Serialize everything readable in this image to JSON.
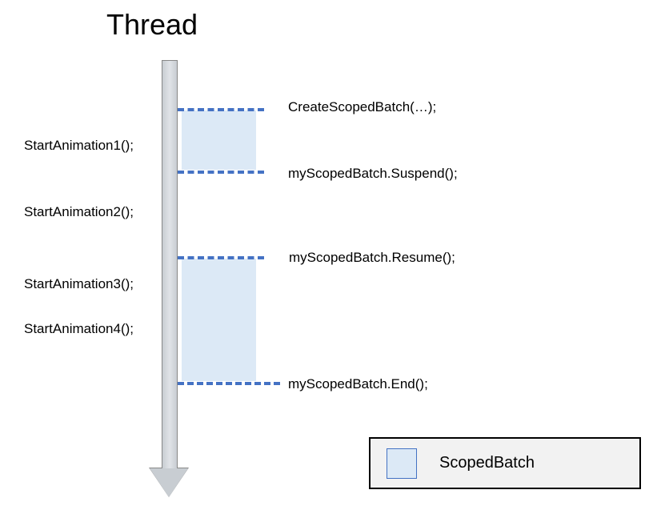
{
  "title": "Thread",
  "leftLabels": {
    "anim1": "StartAnimation1();",
    "anim2": "StartAnimation2();",
    "anim3": "StartAnimation3();",
    "anim4": "StartAnimation4();"
  },
  "rightLabels": {
    "create": "CreateScopedBatch(…);",
    "suspend": "myScopedBatch.Suspend();",
    "resume": "myScopedBatch.Resume();",
    "end": "myScopedBatch.End();"
  },
  "legend": {
    "label": "ScopedBatch"
  },
  "chart_data": {
    "type": "diagram",
    "thread_axis": "vertical",
    "events_left": [
      {
        "name": "StartAnimation1()",
        "position": 1,
        "in_batch": true
      },
      {
        "name": "StartAnimation2()",
        "position": 2,
        "in_batch": false
      },
      {
        "name": "StartAnimation3()",
        "position": 3,
        "in_batch": true
      },
      {
        "name": "StartAnimation4()",
        "position": 4,
        "in_batch": true
      }
    ],
    "batch_segments": [
      {
        "start": "CreateScopedBatch(…)",
        "end": "myScopedBatch.Suspend()",
        "covers": [
          "StartAnimation1()"
        ]
      },
      {
        "start": "myScopedBatch.Resume()",
        "end": "myScopedBatch.End()",
        "covers": [
          "StartAnimation3()",
          "StartAnimation4()"
        ]
      }
    ],
    "legend": "ScopedBatch"
  }
}
